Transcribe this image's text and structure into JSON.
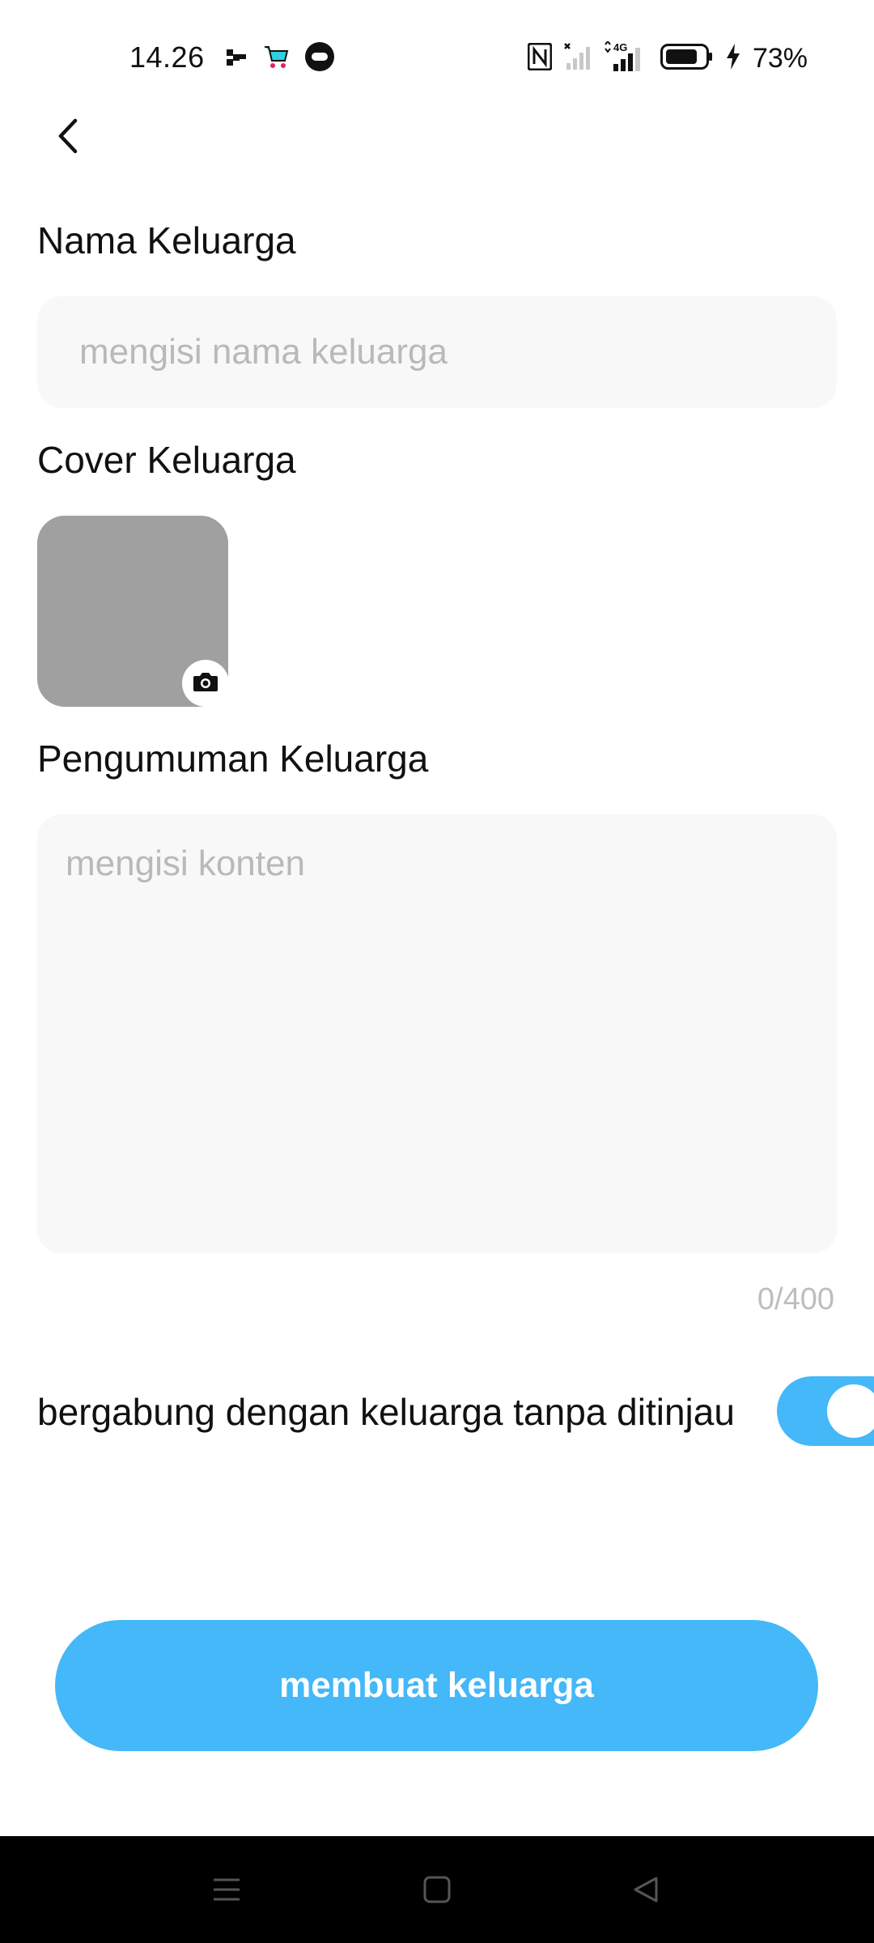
{
  "status_bar": {
    "time": "14.26",
    "battery_percent": "73%",
    "icons": [
      "app-notification-icon",
      "shopping-cart-app-icon",
      "chat-app-icon",
      "nfc-icon",
      "no-signal-icon",
      "4g-signal-icon",
      "battery-icon",
      "charging-bolt-icon"
    ]
  },
  "header": {
    "back_icon": "chevron-left-icon"
  },
  "family_name": {
    "label": "Nama Keluarga",
    "placeholder": "mengisi nama keluarga",
    "value": ""
  },
  "cover": {
    "label": "Cover Keluarga",
    "camera_icon": "camera-icon"
  },
  "announcement": {
    "label": "Pengumuman Keluarga",
    "placeholder": "mengisi konten",
    "value": "",
    "counter": "0/400"
  },
  "join_without_review": {
    "label": "bergabung dengan keluarga tanpa ditinjau",
    "enabled": true
  },
  "submit": {
    "label": "membuat keluarga"
  },
  "nav_bar": {
    "icons": [
      "menu-icon",
      "home-icon",
      "back-triangle-icon"
    ]
  },
  "colors": {
    "accent": "#44b8f8",
    "input_bg": "#f8f8f8",
    "cover_placeholder": "#a0a0a0",
    "nav_bg": "#000000"
  }
}
